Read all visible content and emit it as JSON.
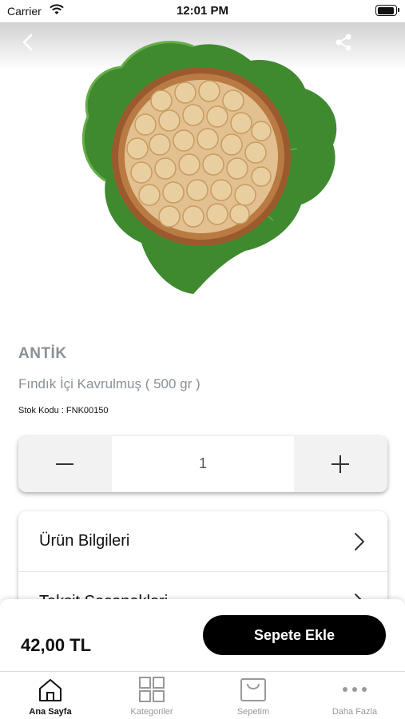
{
  "status_bar": {
    "carrier": "Carrier",
    "time": "12:01 PM"
  },
  "header": {
    "back_icon": "chevron-left-icon",
    "share_icon": "share-icon"
  },
  "product": {
    "image": "hazelnuts-bowl-on-leaf",
    "brand": "ANTİK",
    "name": "Fındık İçi Kavrulmuş ( 500 gr )",
    "stock_code": "Stok Kodu : FNK00150"
  },
  "quantity": {
    "value": "1",
    "minus_icon": "minus-icon",
    "plus_icon": "plus-icon"
  },
  "info_sections": [
    {
      "label": "Ürün Bilgileri"
    },
    {
      "label": "Taksit Seçenekleri"
    }
  ],
  "cart": {
    "price": "42,00 TL",
    "add_button": "Sepete Ekle"
  },
  "tabs": [
    {
      "label": "Ana Sayfa",
      "icon": "home-icon",
      "active": true
    },
    {
      "label": "Kategoriler",
      "icon": "grid-icon",
      "active": false
    },
    {
      "label": "Sepetim",
      "icon": "shopping-bag-icon",
      "active": false
    },
    {
      "label": "Daha Fazla",
      "icon": "more-icon",
      "active": false
    }
  ],
  "colors": {
    "accent": "#000000",
    "muted_text": "#8a9096",
    "tab_inactive": "#999999"
  }
}
